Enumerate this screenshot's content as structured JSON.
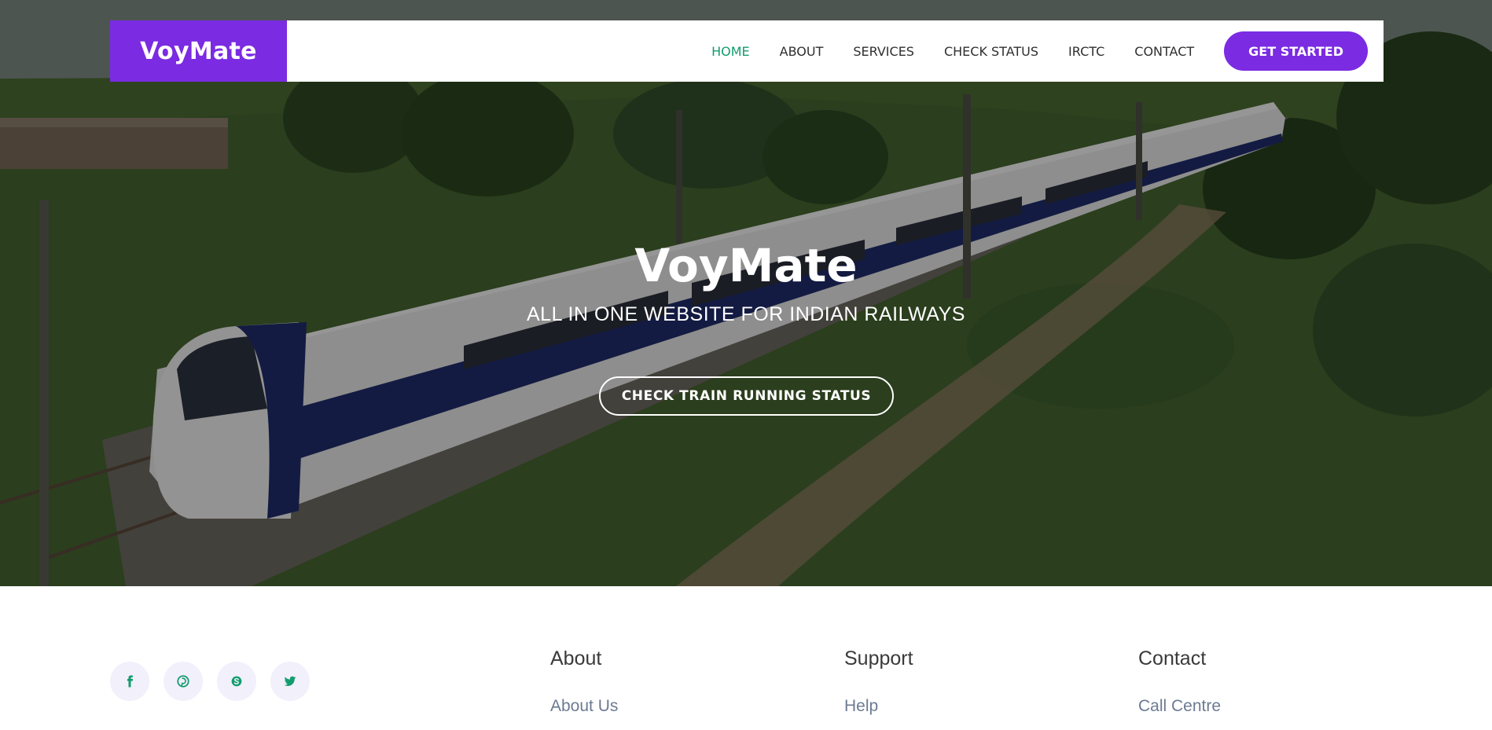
{
  "brand": {
    "name": "VoyMate",
    "accent": "#7b2be2",
    "active": "#149c6e"
  },
  "nav": {
    "items": [
      "HOME",
      "ABOUT",
      "SERVICES",
      "CHECK STATUS",
      "IRCTC",
      "CONTACT"
    ],
    "active": "HOME",
    "cta": "GET STARTED"
  },
  "hero": {
    "title": "VoyMate",
    "subtitle": "ALL IN ONE WEBSITE FOR INDIAN RAILWAYS",
    "button": "CHECK TRAIN RUNNING STATUS"
  },
  "footer": {
    "socials": [
      "facebook-icon",
      "pinterest-icon",
      "skype-icon",
      "twitter-icon"
    ],
    "columns": [
      {
        "title": "About",
        "link": "About Us"
      },
      {
        "title": "Support",
        "link": "Help"
      },
      {
        "title": "Contact",
        "link": "Call Centre"
      }
    ]
  }
}
